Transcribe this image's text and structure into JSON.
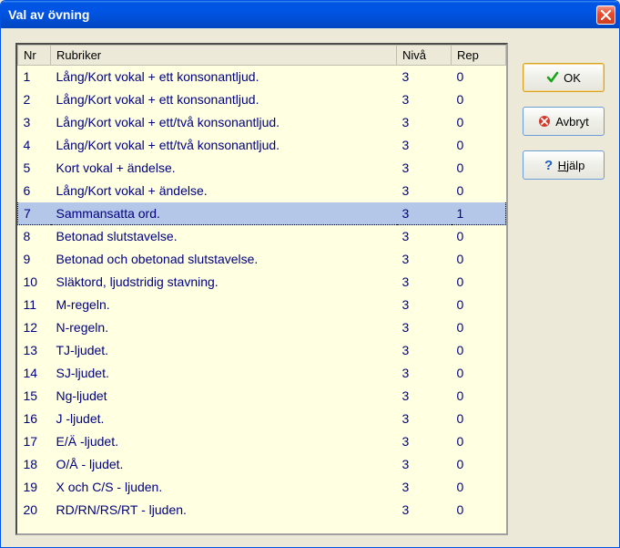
{
  "window": {
    "title": "Val av övning"
  },
  "table": {
    "headers": {
      "nr": "Nr",
      "rubriker": "Rubriker",
      "niva": "Nivå",
      "rep": "Rep"
    },
    "rows": [
      {
        "nr": "1",
        "rubrik": "Lång/Kort vokal + ett konsonantljud.",
        "niva": "3",
        "rep": "0",
        "selected": false
      },
      {
        "nr": "2",
        "rubrik": "Lång/Kort vokal + ett konsonantljud.",
        "niva": "3",
        "rep": "0",
        "selected": false
      },
      {
        "nr": "3",
        "rubrik": "Lång/Kort vokal + ett/två konsonantljud.",
        "niva": "3",
        "rep": "0",
        "selected": false
      },
      {
        "nr": "4",
        "rubrik": "Lång/Kort vokal + ett/två konsonantljud.",
        "niva": "3",
        "rep": "0",
        "selected": false
      },
      {
        "nr": "5",
        "rubrik": "Kort vokal + ändelse.",
        "niva": "3",
        "rep": "0",
        "selected": false
      },
      {
        "nr": "6",
        "rubrik": "Lång/Kort vokal + ändelse.",
        "niva": "3",
        "rep": "0",
        "selected": false
      },
      {
        "nr": "7",
        "rubrik": "Sammansatta ord.",
        "niva": "3",
        "rep": "1",
        "selected": true
      },
      {
        "nr": "8",
        "rubrik": "Betonad slutstavelse.",
        "niva": "3",
        "rep": "0",
        "selected": false
      },
      {
        "nr": "9",
        "rubrik": "Betonad och obetonad slutstavelse.",
        "niva": "3",
        "rep": "0",
        "selected": false
      },
      {
        "nr": "10",
        "rubrik": "Släktord, ljudstridig stavning.",
        "niva": "3",
        "rep": "0",
        "selected": false
      },
      {
        "nr": "11",
        "rubrik": "M-regeln.",
        "niva": "3",
        "rep": "0",
        "selected": false
      },
      {
        "nr": "12",
        "rubrik": "N-regeln.",
        "niva": "3",
        "rep": "0",
        "selected": false
      },
      {
        "nr": "13",
        "rubrik": "TJ-ljudet.",
        "niva": "3",
        "rep": "0",
        "selected": false
      },
      {
        "nr": "14",
        "rubrik": "SJ-ljudet.",
        "niva": "3",
        "rep": "0",
        "selected": false
      },
      {
        "nr": "15",
        "rubrik": "Ng-ljudet",
        "niva": "3",
        "rep": "0",
        "selected": false
      },
      {
        "nr": "16",
        "rubrik": "J -ljudet.",
        "niva": "3",
        "rep": "0",
        "selected": false
      },
      {
        "nr": "17",
        "rubrik": "E/Ä -ljudet.",
        "niva": "3",
        "rep": "0",
        "selected": false
      },
      {
        "nr": "18",
        "rubrik": "O/Å - ljudet.",
        "niva": "3",
        "rep": "0",
        "selected": false
      },
      {
        "nr": "19",
        "rubrik": "X och C/S - ljuden.",
        "niva": "3",
        "rep": "0",
        "selected": false
      },
      {
        "nr": "20",
        "rubrik": "RD/RN/RS/RT - ljuden.",
        "niva": "3",
        "rep": "0",
        "selected": false
      }
    ]
  },
  "buttons": {
    "ok": "OK",
    "cancel": "Avbryt",
    "help_prefix": "H",
    "help_rest": "jälp"
  },
  "icons": {
    "check": "check-icon",
    "cancel": "cancel-icon",
    "help": "help-icon",
    "close": "close-icon"
  }
}
